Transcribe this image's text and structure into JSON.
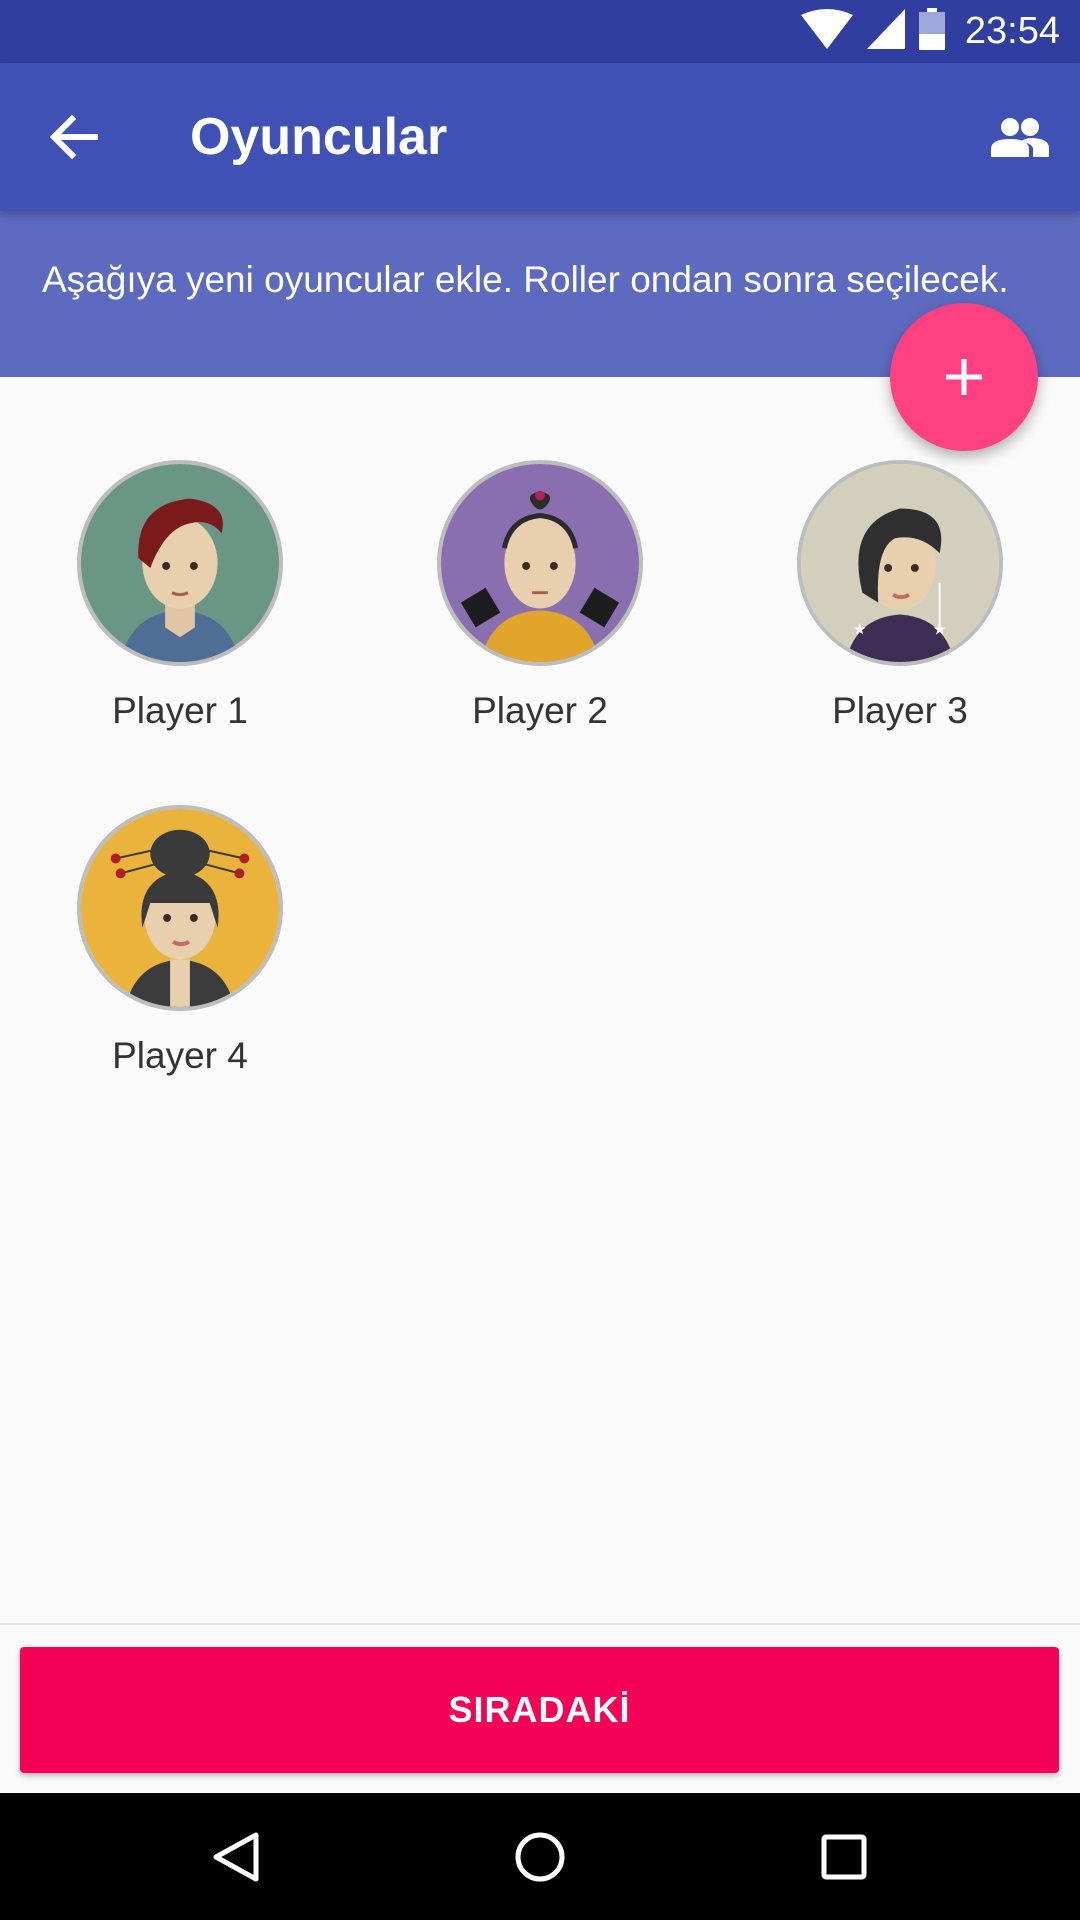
{
  "status_bar": {
    "time": "23:54",
    "icons": [
      "wifi-icon",
      "signal-icon",
      "battery-icon"
    ]
  },
  "app_bar": {
    "title": "Oyuncular",
    "back_icon": "arrow-back-icon",
    "people_icon": "people-icon",
    "color": "#3f51b5"
  },
  "banner": {
    "text": "Aşağıya yeni oyuncular ekle. Roller ondan sonra seçilecek."
  },
  "fab": {
    "icon": "plus-icon",
    "color": "#ff4081"
  },
  "players": [
    {
      "name": "Player 1",
      "avatar_bg": "#6a9686"
    },
    {
      "name": "Player 2",
      "avatar_bg": "#8a6fb0"
    },
    {
      "name": "Player 3",
      "avatar_bg": "#d3cfbd"
    },
    {
      "name": "Player 4",
      "avatar_bg": "#e9b33c"
    }
  ],
  "footer": {
    "next_label": "SIRADAKİ",
    "color": "#f50057"
  },
  "nav_bar": {
    "icons": [
      "back-triangle-icon",
      "home-circle-icon",
      "recents-square-icon"
    ]
  }
}
